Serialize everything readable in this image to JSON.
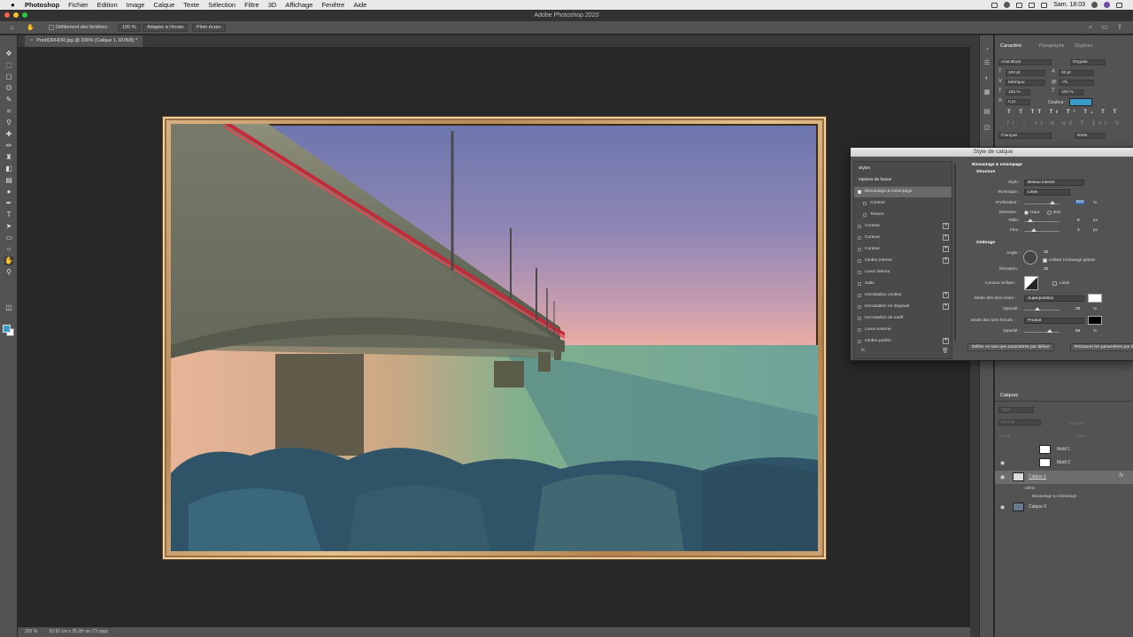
{
  "menubar": {
    "app": "Photoshop",
    "items": [
      "Fichier",
      "Edition",
      "Image",
      "Calque",
      "Texte",
      "Sélection",
      "Filtre",
      "3D",
      "Affichage",
      "Fenêtre",
      "Aide"
    ],
    "clock": "Sam. 18:03"
  },
  "window": {
    "title": "Adobe Photoshop 2020"
  },
  "options": {
    "scroll_all": "Défilement des fenêtres",
    "zoom": "100 %",
    "fit": "Adapter à l'écran",
    "fill": "Plein écran"
  },
  "document": {
    "tab": "PontIDRHDR.jpg @ 200% (Calque 1, RVB/8) *"
  },
  "status": {
    "zoom": "200 %",
    "size": "52,92 cm x 35,28 cm (72 ppp)"
  },
  "character": {
    "tabs": [
      "Caractère",
      "Paragraphe",
      "Glyphes"
    ],
    "font": "Arial Black",
    "style": "Regular",
    "size": "100 pt",
    "leading": "60 pt",
    "kerning": "Métrique",
    "tracking": "-75",
    "vscale": "100 %",
    "hscale": "100 %",
    "baseline": "0 pt",
    "color_label": "Couleur :",
    "color": "#3a9ac8",
    "glyphs": "T T TT Tr T¹ T₁ T T",
    "ligs": "fi ♂ st A ad T 1st ½",
    "language": "Français",
    "aa": "Nette"
  },
  "dialog": {
    "title": "Style de calque",
    "left": {
      "styles": "Styles",
      "blend": "Options de fusion",
      "items": [
        {
          "label": "Biseautage & estampage",
          "checked": true,
          "plus": false,
          "indent": false,
          "sel": true
        },
        {
          "label": "Contour",
          "checked": false,
          "plus": false,
          "indent": true,
          "sel": false
        },
        {
          "label": "Texture",
          "checked": false,
          "plus": false,
          "indent": true,
          "sel": false
        },
        {
          "label": "Contour",
          "checked": false,
          "plus": true,
          "indent": false,
          "sel": false
        },
        {
          "label": "Contour",
          "checked": false,
          "plus": true,
          "indent": false,
          "sel": false
        },
        {
          "label": "Contour",
          "checked": false,
          "plus": true,
          "indent": false,
          "sel": false
        },
        {
          "label": "Ombre interne",
          "checked": false,
          "plus": true,
          "indent": false,
          "sel": false
        },
        {
          "label": "Lueur interne",
          "checked": false,
          "plus": false,
          "indent": false,
          "sel": false
        },
        {
          "label": "Satin",
          "checked": false,
          "plus": false,
          "indent": false,
          "sel": false
        },
        {
          "label": "Incrustation couleur",
          "checked": false,
          "plus": true,
          "indent": false,
          "sel": false
        },
        {
          "label": "Incrustation en dégradé",
          "checked": false,
          "plus": true,
          "indent": false,
          "sel": false
        },
        {
          "label": "Incrustation de motif",
          "checked": false,
          "plus": false,
          "indent": false,
          "sel": false
        },
        {
          "label": "Lueur externe",
          "checked": false,
          "plus": false,
          "indent": false,
          "sel": false
        },
        {
          "label": "Ombre portée",
          "checked": false,
          "plus": true,
          "indent": false,
          "sel": false
        }
      ],
      "fx": "fx."
    },
    "right": {
      "section": "Biseautage & estampage",
      "structure": "Structure",
      "style_label": "Style :",
      "style_value": "Biseau interne",
      "tech_label": "Technique :",
      "tech_value": "Lisse",
      "depth_label": "Profondeur :",
      "depth_value": "815",
      "pct": "%",
      "dir_label": "Direction :",
      "dir_up": "Haut",
      "dir_down": "Bas",
      "size_label": "Taille :",
      "size_value": "8",
      "px": "px",
      "soft_label": "Flou :",
      "soft_value": "3",
      "shading": "Ombrage",
      "angle_label": "Angle :",
      "angle_value": "30",
      "global_light": "Utiliser l'éclairage global",
      "alt_label": "Elévation :",
      "alt_value": "30",
      "gloss_label": "Contour brillant :",
      "smooth": "Lissé",
      "hl_mode_label": "Mode des tons clairs :",
      "hl_mode": "Superposition",
      "hl_color": "#ffffff",
      "hl_op_label": "Opacité :",
      "hl_op": "28",
      "sh_mode_label": "Mode des tons foncés :",
      "sh_mode": "Produit",
      "sh_color": "#000000",
      "sh_op_label": "Opacité :",
      "sh_op": "56",
      "btn_default": "Définir en tant que paramètres par défaut",
      "btn_reset": "Restaurer les paramètres par défaut"
    }
  },
  "layers": {
    "title": "Calques",
    "kind": "Type",
    "blend": "Normal",
    "opacity_label": "Opacité :",
    "lock_label": "Verrou :",
    "fill_label": "Fond :",
    "rows": [
      {
        "name": "Motif 1",
        "eye": false,
        "sel": false
      },
      {
        "name": "Motif 2",
        "eye": true,
        "sel": false
      },
      {
        "name": "Calque 1",
        "eye": true,
        "sel": true,
        "fx": "fx"
      },
      {
        "name": "Calque 0",
        "eye": true,
        "sel": false
      }
    ],
    "effects": "Effets",
    "effect_item": "Biseautage & estampage"
  }
}
